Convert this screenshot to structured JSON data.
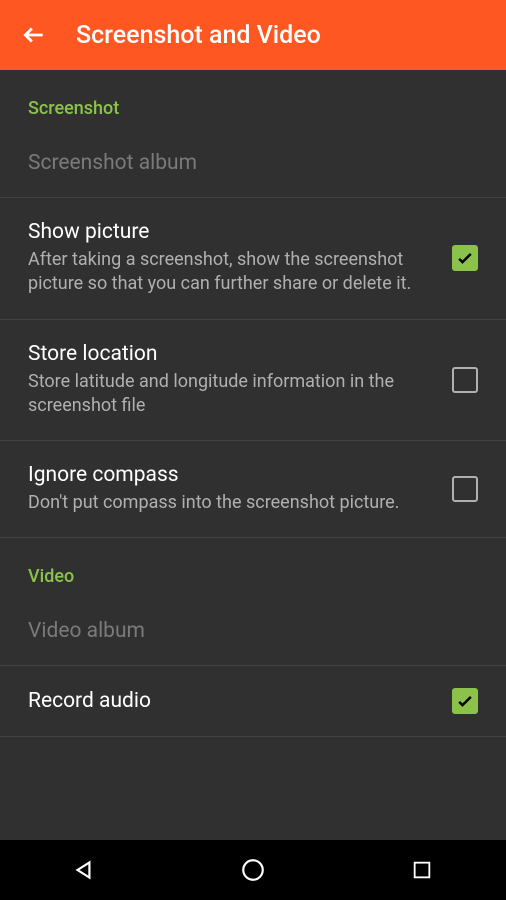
{
  "header": {
    "title": "Screenshot and Video"
  },
  "sections": {
    "screenshot": {
      "label": "Screenshot",
      "album": "Screenshot album",
      "showPicture": {
        "title": "Show picture",
        "desc": "After taking a screenshot, show the screenshot picture so that you can further share or delete it.",
        "checked": true
      },
      "storeLocation": {
        "title": "Store location",
        "desc": "Store latitude and longitude information in the screenshot file",
        "checked": false
      },
      "ignoreCompass": {
        "title": "Ignore compass",
        "desc": "Don't put compass into the screenshot picture.",
        "checked": false
      }
    },
    "video": {
      "label": "Video",
      "album": "Video album",
      "recordAudio": {
        "title": "Record audio",
        "checked": true
      }
    }
  }
}
